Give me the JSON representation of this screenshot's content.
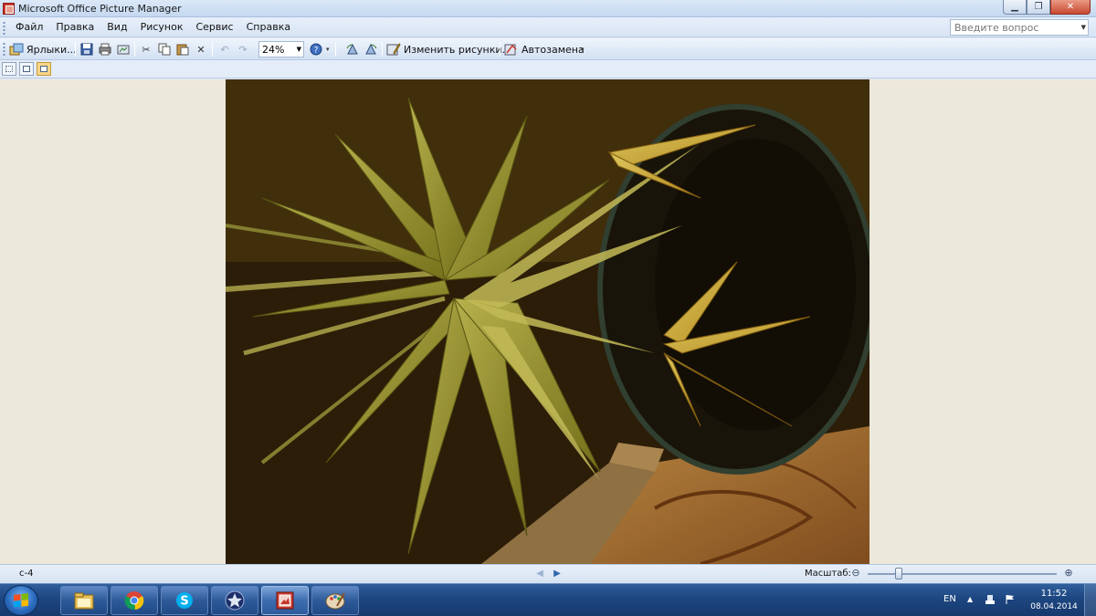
{
  "window": {
    "title": "Microsoft Office Picture Manager"
  },
  "menu": {
    "items": [
      "Файл",
      "Правка",
      "Вид",
      "Рисунок",
      "Сервис",
      "Справка"
    ],
    "question_placeholder": "Введите вопрос"
  },
  "toolbar": {
    "shortcuts_label": "Ярлыки...",
    "zoom_value": "24%",
    "edit_pictures_label": "Изменить рисунки...",
    "auto_correct_label": "Автозамена"
  },
  "status": {
    "file_name": "с-4",
    "zoom_label": "Масштаб:",
    "zoom_slider_position_fraction": 0.15
  },
  "taskbar": {
    "language": "EN",
    "time": "11:52",
    "date": "08.04.2014",
    "apps": [
      "explorer",
      "chrome",
      "skype",
      "star-app",
      "picture-manager",
      "paint"
    ]
  },
  "colors": {
    "taskbar": "#1d4680",
    "title_bar": "#c4d8f0",
    "workspace": "#ece8da",
    "close_button": "#c94a31"
  }
}
